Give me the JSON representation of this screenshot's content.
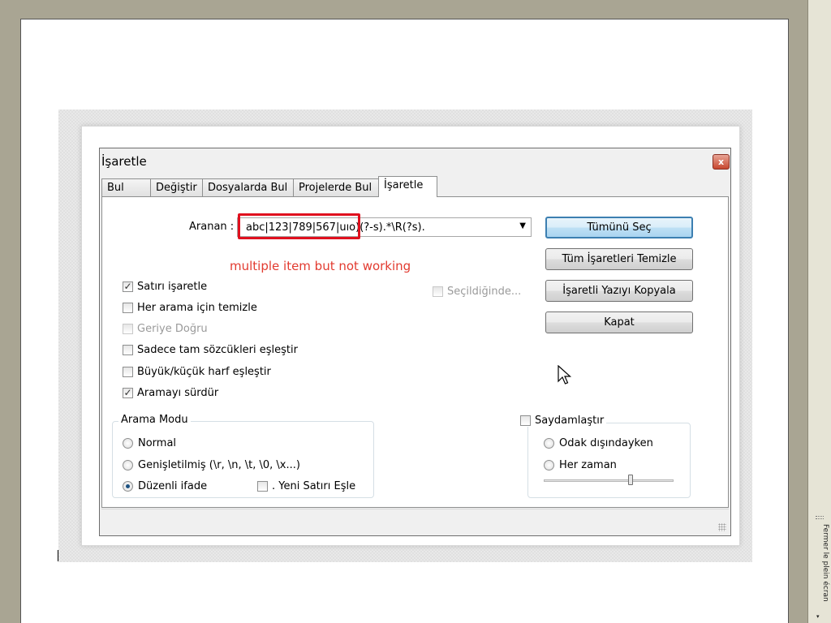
{
  "dialog": {
    "title": "İşaretle",
    "tabs": [
      "Bul",
      "Değiştir",
      "Dosyalarda Bul",
      "Projelerde Bul",
      "İşaretle"
    ],
    "active_tab": "İşaretle",
    "search_label": "Aranan :",
    "search_value": "abc|123|789|567|uıo)(?-s).*\\R(?s).",
    "annotation": "multiple item but not working",
    "buttons": {
      "select_all": "Tümünü Seç",
      "clear_marks": "Tüm İşaretleri Temizle",
      "copy_marked": "İşaretli Yazıyı Kopyala",
      "close": "Kapat"
    },
    "options": {
      "mark_line": {
        "label": "Satırı işaretle",
        "checked": true
      },
      "purge": {
        "label": "Her arama için temizle",
        "checked": false
      },
      "backward": {
        "label": "Geriye Doğru",
        "checked": false,
        "disabled": true
      },
      "whole_word": {
        "label": "Sadece tam sözcükleri eşleştir",
        "checked": false
      },
      "match_case": {
        "label": "Büyük/küçük harf eşleştir",
        "checked": false
      },
      "wrap": {
        "label": "Aramayı sürdür",
        "checked": true
      },
      "in_selection": {
        "label": "Seçildiğinde...",
        "checked": false,
        "disabled": true
      }
    },
    "search_mode": {
      "label": "Arama Modu",
      "normal": "Normal",
      "extended": "Genişletilmiş (\\r, \\n, \\t, \\0, \\x...)",
      "regex": "Düzenli ifade",
      "selected": "regex",
      "dot_newline": ". Yeni Satırı Eşle"
    },
    "transparency": {
      "label": "Saydamlaştır",
      "on_losing_focus": "Odak dışındayken",
      "always": "Her zaman",
      "selected": "on_losing_focus"
    }
  },
  "side_panel": {
    "fullscreen_label": "Fermer le plein écran"
  }
}
